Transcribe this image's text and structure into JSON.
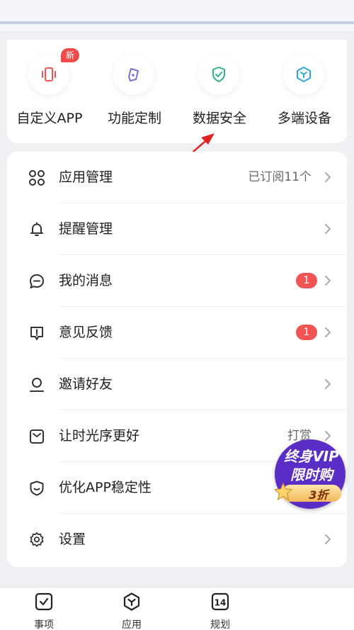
{
  "quick_actions": [
    {
      "label": "自定义APP",
      "icon": "phone-vibrate-icon",
      "color": "#f05454",
      "badge": "新"
    },
    {
      "label": "功能定制",
      "icon": "pen-tool-icon",
      "color": "#7b6cd6"
    },
    {
      "label": "数据安全",
      "icon": "shield-check-icon",
      "color": "#2fb18c"
    },
    {
      "label": "多端设备",
      "icon": "hex-devices-icon",
      "color": "#2aa7e0"
    }
  ],
  "menu": [
    {
      "label": "应用管理",
      "icon": "apps-grid-icon",
      "right_text": "已订阅11个"
    },
    {
      "label": "提醒管理",
      "icon": "bell-icon"
    },
    {
      "label": "我的消息",
      "icon": "chat-bubble-icon",
      "badge": "1"
    },
    {
      "label": "意见反馈",
      "icon": "feedback-icon",
      "badge": "1"
    },
    {
      "label": "邀请好友",
      "icon": "person-icon"
    },
    {
      "label": "让时光序更好",
      "icon": "envelope-heart-icon",
      "right_text": "打赏"
    },
    {
      "label": "优化APP稳定性",
      "icon": "shield-smile-icon"
    },
    {
      "label": "设置",
      "icon": "gear-icon"
    }
  ],
  "vip_promo": {
    "line1": "终身VIP",
    "line2": "限时购",
    "tag": "3折",
    "colors": {
      "bg": "#5a2ec6",
      "tag": "#f0b85c"
    }
  },
  "bottom_tabs": [
    {
      "label": "事项",
      "icon": "check-square-icon"
    },
    {
      "label": "应用",
      "icon": "hex-app-icon"
    },
    {
      "label": "规划",
      "icon": "calendar-icon",
      "icon_text": "14"
    }
  ],
  "colors": {
    "accent_red": "#f05454",
    "arrow_red": "#e02424"
  }
}
